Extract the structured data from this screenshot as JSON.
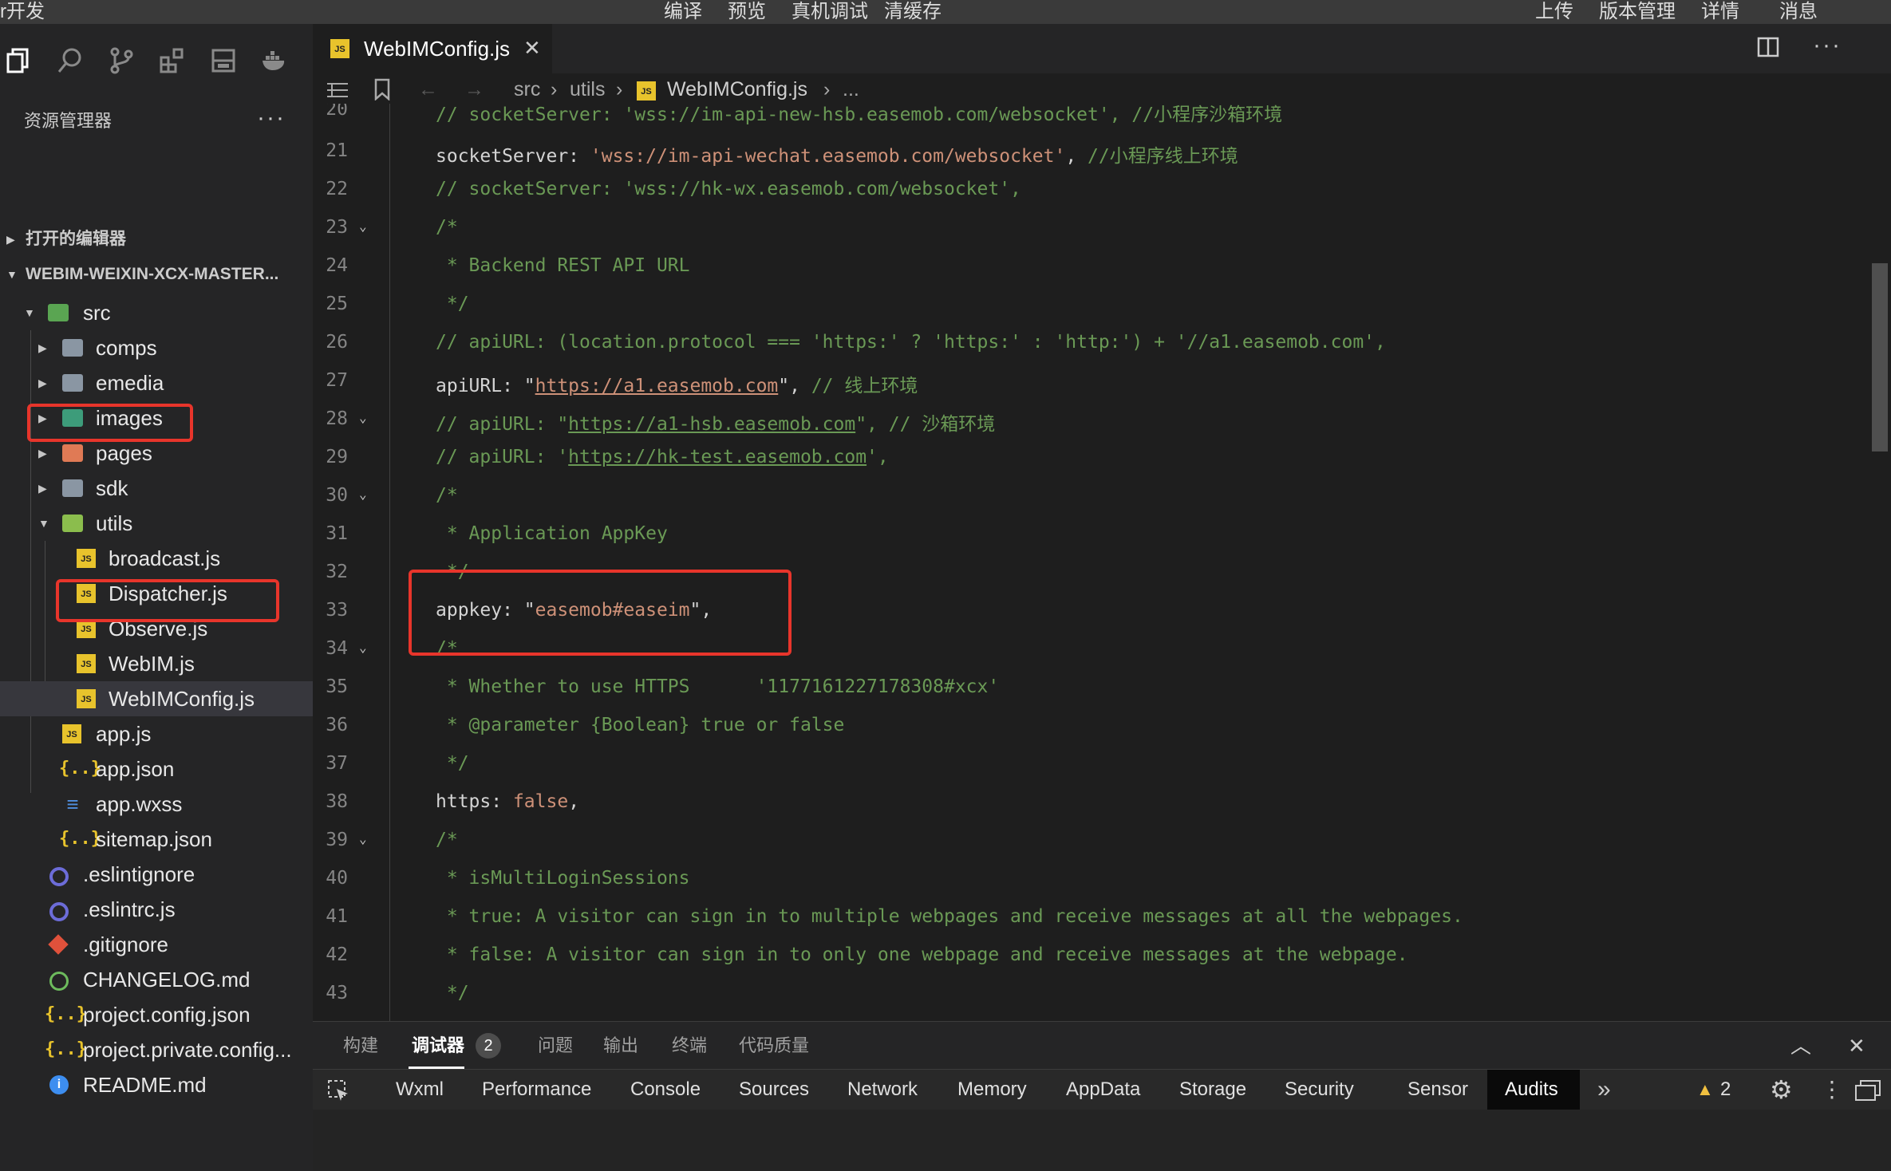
{
  "menubar": {
    "app_fragment": "r开发",
    "center_items": [
      "编译",
      "预览",
      "真机调试",
      "清缓存"
    ],
    "right_items": [
      "上传",
      "版本管理",
      "详情",
      "消息"
    ]
  },
  "sidebar": {
    "title": "资源管理器",
    "more": "···",
    "open_editors": "打开的编辑器",
    "project": "WEBIM-WEIXIN-XCX-MASTER...",
    "tree": [
      {
        "name": "src",
        "icon": "folder-src-icon"
      },
      {
        "name": "comps",
        "icon": "folder-icon"
      },
      {
        "name": "emedia",
        "icon": "folder-icon"
      },
      {
        "name": "images",
        "icon": "folder-images-icon"
      },
      {
        "name": "pages",
        "icon": "folder-pages-icon"
      },
      {
        "name": "sdk",
        "icon": "folder-icon"
      },
      {
        "name": "utils",
        "icon": "folder-utils-icon"
      },
      {
        "name": "broadcast.js",
        "icon": "js-file-icon"
      },
      {
        "name": "Dispatcher.js",
        "icon": "js-file-icon"
      },
      {
        "name": "Observe.js",
        "icon": "js-file-icon"
      },
      {
        "name": "WebIM.js",
        "icon": "js-file-icon"
      },
      {
        "name": "WebIMConfig.js",
        "icon": "js-file-icon"
      },
      {
        "name": "app.js",
        "icon": "js-file-icon"
      },
      {
        "name": "app.json",
        "icon": "json-file-icon"
      },
      {
        "name": "app.wxss",
        "icon": "css-file-icon"
      },
      {
        "name": "sitemap.json",
        "icon": "json-file-icon"
      },
      {
        "name": ".eslintignore",
        "icon": "eslint-icon"
      },
      {
        "name": ".eslintrc.js",
        "icon": "eslint-icon"
      },
      {
        "name": ".gitignore",
        "icon": "git-icon"
      },
      {
        "name": "CHANGELOG.md",
        "icon": "history-icon"
      },
      {
        "name": "project.config.json",
        "icon": "json-file-icon"
      },
      {
        "name": "project.private.config...",
        "icon": "json-file-icon"
      },
      {
        "name": "README.md",
        "icon": "info-icon"
      }
    ]
  },
  "editor": {
    "tab_label": "WebIMConfig.js",
    "js_badge": "JS",
    "json_badge": "{..}",
    "info_badge": "i",
    "breadcrumb": [
      "src",
      "utils",
      "WebIMConfig.js",
      "..."
    ],
    "lines": [
      {
        "n": "20",
        "text": "// socketServer: 'wss://im-api-new-hsb.easemob.com/websocket', //小程序沙箱环境"
      },
      {
        "n": "21",
        "text": "socketServer: 'wss://im-api-wechat.easemob.com/websocket', //小程序线上环境"
      },
      {
        "n": "22",
        "text": "// socketServer: 'wss://hk-wx.easemob.com/websocket',"
      },
      {
        "n": "23",
        "text": "/*"
      },
      {
        "n": "24",
        "text": " * Backend REST API URL"
      },
      {
        "n": "25",
        "text": " */"
      },
      {
        "n": "26",
        "text": "// apiURL: (location.protocol === 'https:' ? 'https:' : 'http:') + '//a1.easemob.com',"
      },
      {
        "n": "27",
        "text": "apiURL: \"https://a1.easemob.com\", // 线上环境"
      },
      {
        "n": "28",
        "text": "// apiURL: \"https://a1-hsb.easemob.com\", // 沙箱环境"
      },
      {
        "n": "29",
        "text": "// apiURL: 'https://hk-test.easemob.com',"
      },
      {
        "n": "30",
        "text": "/*"
      },
      {
        "n": "31",
        "text": " * Application AppKey"
      },
      {
        "n": "32",
        "text": " */"
      },
      {
        "n": "33",
        "text": "appkey: \"easemob#easeim\","
      },
      {
        "n": "34",
        "text": "/*"
      },
      {
        "n": "35",
        "text": " * Whether to use HTTPS      '1177161227178308#xcx'"
      },
      {
        "n": "36",
        "text": " * @parameter {Boolean} true or false"
      },
      {
        "n": "37",
        "text": " */"
      },
      {
        "n": "38",
        "text": "https: false,"
      },
      {
        "n": "39",
        "text": "/*"
      },
      {
        "n": "40",
        "text": " * isMultiLoginSessions"
      },
      {
        "n": "41",
        "text": " * true: A visitor can sign in to multiple webpages and receive messages at all the webpages."
      },
      {
        "n": "42",
        "text": " * false: A visitor can sign in to only one webpage and receive messages at the webpage."
      },
      {
        "n": "43",
        "text": " */"
      }
    ],
    "code": {
      "l21_key": "socketServer: ",
      "l21_str": "'wss://im-api-wechat.easemob.com/websocket'",
      "l21_rest": ", ",
      "l21_cm": "//小程序线上环境",
      "l27_key": "apiURL: \"",
      "l27_url": "https://a1.easemob.com",
      "l27_q": "\", ",
      "l27_cm": "// 线上环境",
      "l28_pre": "// apiURL: \"",
      "l28_url": "https://a1-hsb.easemob.com",
      "l28_post": "\", // 沙箱环境",
      "l29_pre": "// apiURL: '",
      "l29_url": "https://hk-test.easemob.com",
      "l29_post": "',",
      "l33_key": "appkey: \"",
      "l33_str": "easemob#easeim",
      "l33_end": "\",",
      "l38_key": "https: ",
      "l38_val": "false",
      "l38_end": ","
    }
  },
  "panel": {
    "tabs": [
      "构建",
      "调试器",
      "问题",
      "输出",
      "终端",
      "代码质量"
    ],
    "debugger_badge": "2",
    "devtools_tabs": [
      "Wxml",
      "Performance",
      "Console",
      "Sources",
      "Network",
      "Memory",
      "AppData",
      "Storage",
      "Security",
      "Sensor",
      "Audits"
    ],
    "active_devtools_tab": "Audits",
    "warning_count": "2"
  },
  "colors": {
    "highlight_box": "#e8352b",
    "comment": "#6a9955",
    "string": "#ce9178",
    "background": "#1e1e1e"
  }
}
